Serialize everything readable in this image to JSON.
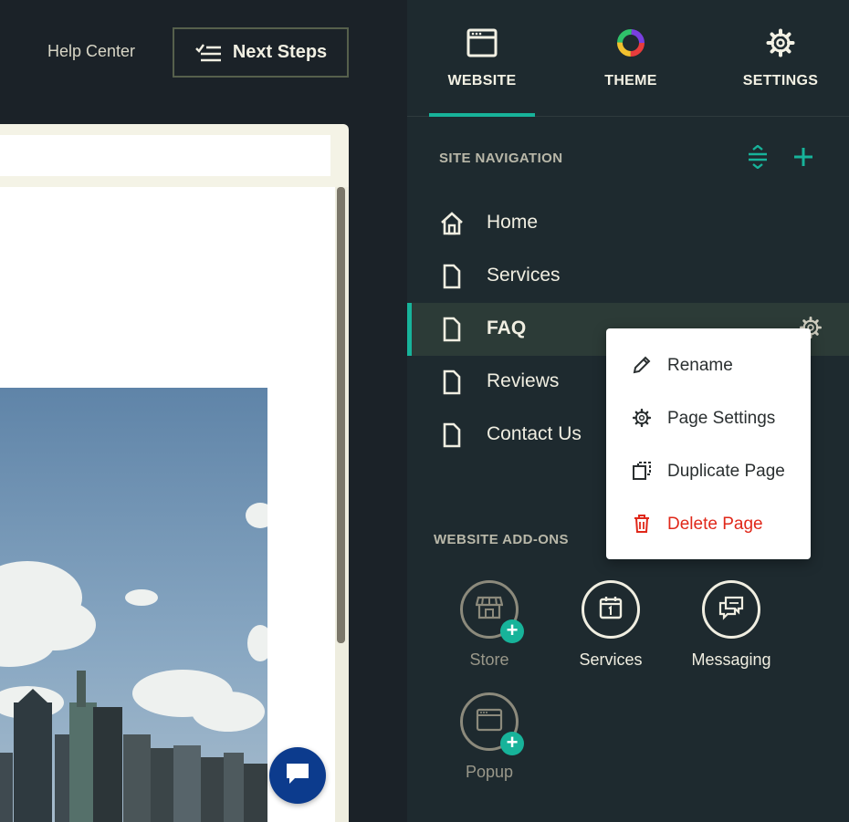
{
  "header": {
    "help_center": "Help Center",
    "next_steps": "Next Steps"
  },
  "tabs": [
    {
      "label": "WEBSITE",
      "icon": "browser-window-icon",
      "active": true
    },
    {
      "label": "THEME",
      "icon": "color-wheel-icon",
      "active": false
    },
    {
      "label": "SETTINGS",
      "icon": "gear-icon",
      "active": false
    }
  ],
  "site_navigation": {
    "title": "SITE NAVIGATION",
    "reorder_icon": "reorder-icon",
    "add_icon": "plus-icon",
    "items": [
      {
        "label": "Home",
        "icon": "home-icon",
        "active": false
      },
      {
        "label": "Services",
        "icon": "page-icon",
        "active": false
      },
      {
        "label": "FAQ",
        "icon": "page-icon",
        "active": true
      },
      {
        "label": "Reviews",
        "icon": "page-icon",
        "active": false
      },
      {
        "label": "Contact Us",
        "icon": "page-icon",
        "active": false
      }
    ]
  },
  "context_menu": {
    "items": [
      {
        "label": "Rename",
        "icon": "pencil-icon"
      },
      {
        "label": "Page Settings",
        "icon": "gear-icon"
      },
      {
        "label": "Duplicate Page",
        "icon": "duplicate-icon"
      },
      {
        "label": "Delete Page",
        "icon": "trash-icon",
        "color": "#e0281a"
      }
    ]
  },
  "addons": {
    "title": "WEBSITE ADD-ONS",
    "items": [
      {
        "label": "Store",
        "icon": "store-icon",
        "enabled": false
      },
      {
        "label": "Services",
        "icon": "calendar-icon",
        "enabled": true
      },
      {
        "label": "Messaging",
        "icon": "chat-bubbles-icon",
        "enabled": true
      },
      {
        "label": "Popup",
        "icon": "popup-window-icon",
        "enabled": false
      }
    ]
  },
  "colors": {
    "accent": "#17b39a",
    "panel_bg": "#1e2a2f",
    "danger": "#e0281a",
    "chat_button": "#0c3b8d"
  }
}
